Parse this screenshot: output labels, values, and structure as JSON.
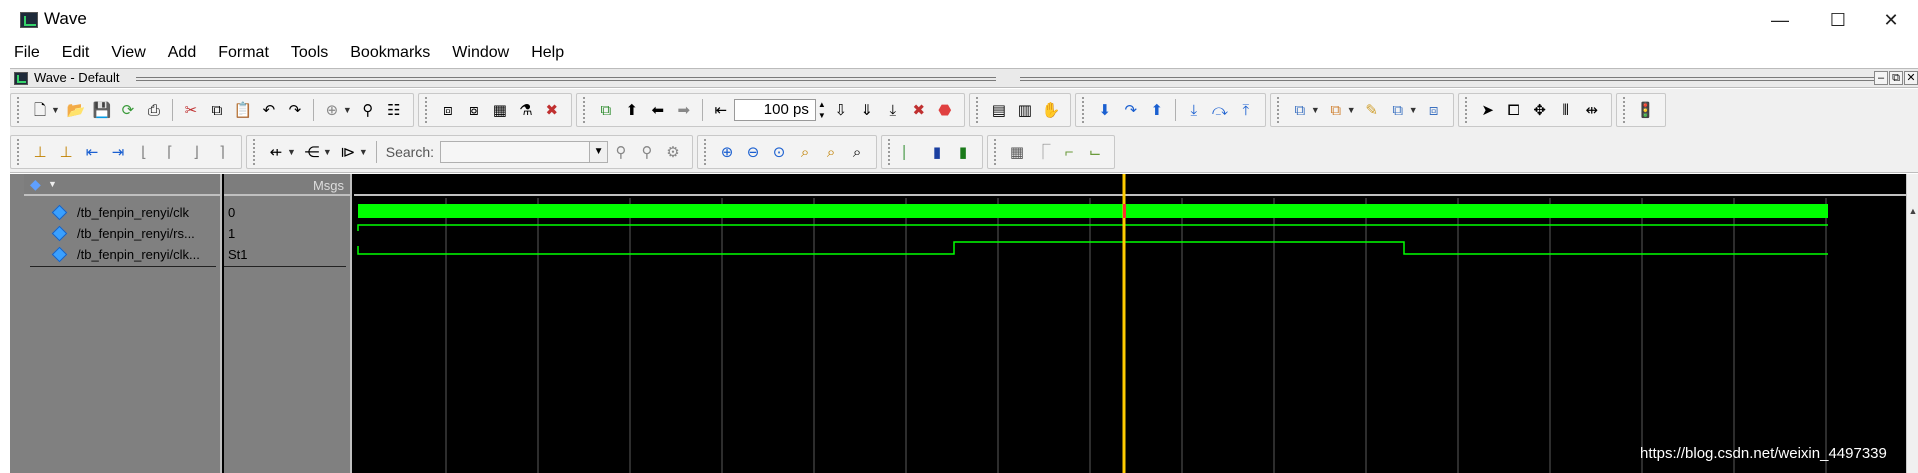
{
  "window": {
    "title": "Wave",
    "minimize": "—",
    "maximize": "☐",
    "close": "✕"
  },
  "menubar": [
    "File",
    "Edit",
    "View",
    "Add",
    "Format",
    "Tools",
    "Bookmarks",
    "Window",
    "Help"
  ],
  "subwindow": {
    "title": "Wave - Default"
  },
  "toolbar": {
    "zoom_value": "100 ps",
    "search_label": "Search:",
    "search_value": ""
  },
  "panes": {
    "values_header": "Msgs"
  },
  "signals": [
    {
      "name": "/tb_fenpin_renyi/clk",
      "value": "0"
    },
    {
      "name": "/tb_fenpin_renyi/rs...",
      "value": "1"
    },
    {
      "name": "/tb_fenpin_renyi/clk...",
      "value": "St1"
    }
  ],
  "colors": {
    "wave": "#00ff00",
    "cursor": "#ffcc00",
    "cursor_marker": "#ff3030",
    "grid": "#5a5a5a",
    "pane_bg": "#808080",
    "canvas_bg": "#000000"
  },
  "watermark": "https://blog.csdn.net/weixin_4497339"
}
